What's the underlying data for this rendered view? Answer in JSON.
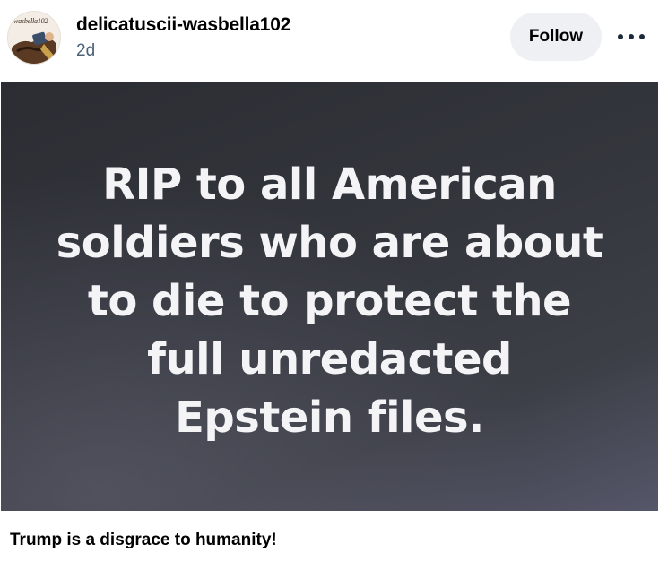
{
  "post": {
    "author": {
      "username": "delicatuscii-wasbella102",
      "avatar_text": "wasbella102"
    },
    "timestamp": "2d",
    "follow_label": "Follow",
    "more_icon": "more-options-icon",
    "image": {
      "lines": [
        "RIP to all American",
        "soldiers who are about",
        "to die to protect the",
        "full unredacted",
        "Epstein files."
      ]
    },
    "caption": "Trump is a disgrace to humanity!"
  },
  "colors": {
    "timestamp": "#4a6178",
    "follow_bg": "#eef0f3",
    "image_bg": "#34363d",
    "image_text": "#f4f4f6"
  }
}
